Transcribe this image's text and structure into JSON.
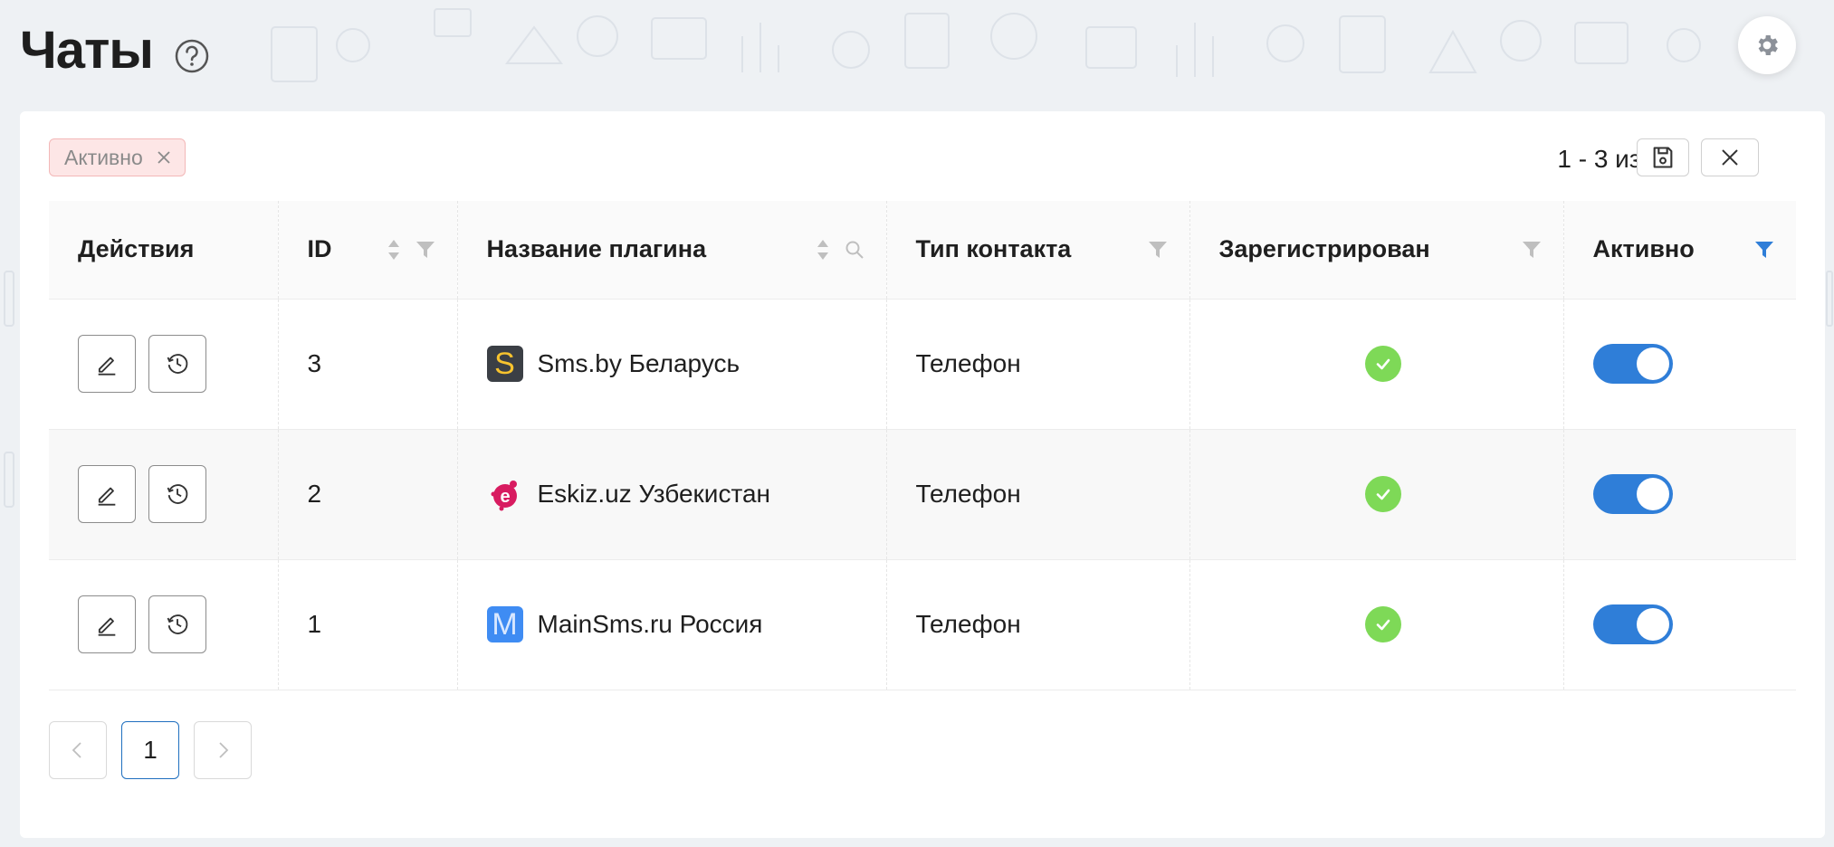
{
  "page": {
    "title": "Чаты"
  },
  "filter_tag": {
    "label": "Активно"
  },
  "pager": {
    "info": "1 - 3 из 3"
  },
  "table": {
    "columns": [
      "Действия",
      "ID",
      "Название плагина",
      "Тип контакта",
      "Зарегистрирован",
      "Активно"
    ],
    "rows": [
      {
        "id": "3",
        "plugin": "Sms.by Беларусь",
        "logo_letter": "S",
        "contact_type": "Телефон",
        "registered": true,
        "active": true
      },
      {
        "id": "2",
        "plugin": "Eskiz.uz Узбекистан",
        "logo_letter": "e",
        "contact_type": "Телефон",
        "registered": true,
        "active": true
      },
      {
        "id": "1",
        "plugin": "MainSms.ru Россия",
        "logo_letter": "M",
        "contact_type": "Телефон",
        "registered": true,
        "active": true
      }
    ]
  },
  "pagination": {
    "current": "1"
  },
  "icons": {
    "help": "question-circle-icon",
    "settings": "gear-icon",
    "save": "floppy-disk-icon",
    "close": "close-icon",
    "edit": "pencil-icon",
    "history": "history-clock-icon",
    "sort": "sort-icon",
    "filter": "filter-funnel-icon",
    "search": "search-icon",
    "check": "check-icon",
    "prev": "chevron-left-icon",
    "next": "chevron-right-icon"
  },
  "colors": {
    "accent": "#2f7ed8",
    "success": "#7ed957",
    "tag_background": "#fde6e6",
    "active_filter": "#2f7ed8"
  }
}
